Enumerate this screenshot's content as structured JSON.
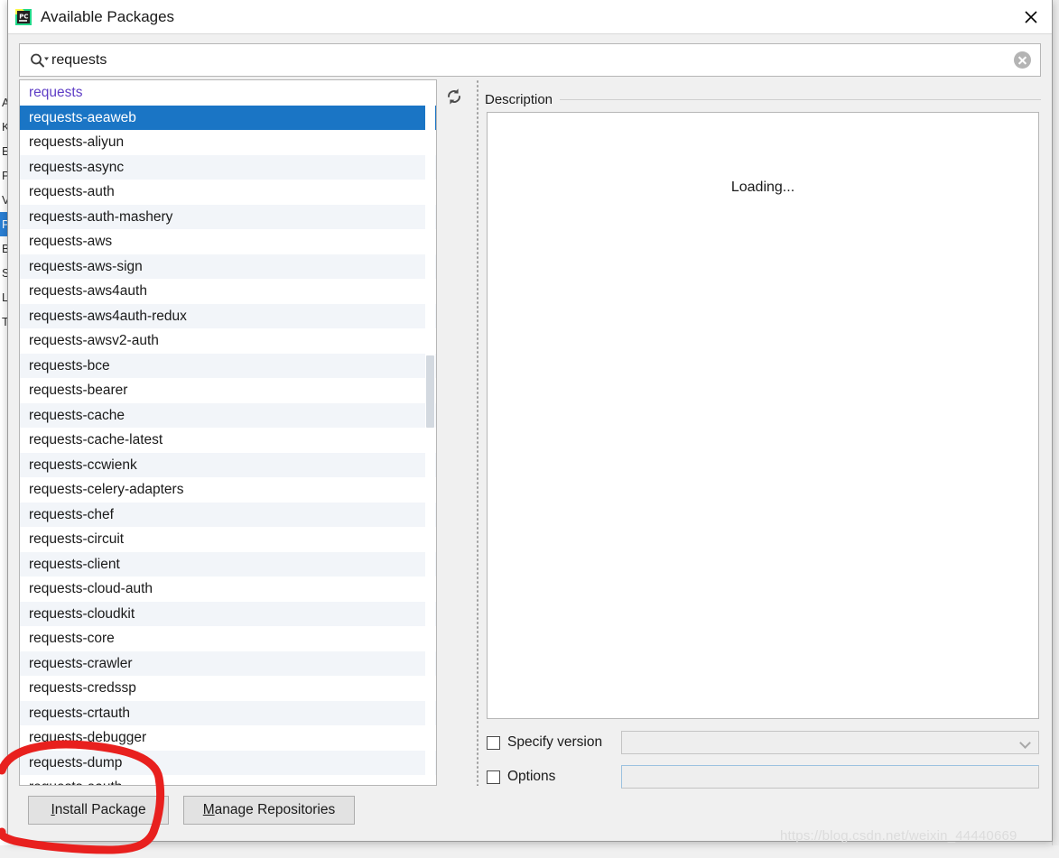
{
  "window": {
    "title": "Available Packages",
    "app_icon": "pycharm-icon",
    "close_icon": "close-icon",
    "accent_color": "#1a75c5",
    "installed_color": "#5f3ec6"
  },
  "search": {
    "value": "requests",
    "placeholder": "",
    "icon": "search-icon",
    "clear_icon": "clear-icon"
  },
  "list": {
    "refresh_icon": "refresh-icon",
    "selected_index": 1,
    "installed_index": 0,
    "items": [
      "requests",
      "requests-aeaweb",
      "requests-aliyun",
      "requests-async",
      "requests-auth",
      "requests-auth-mashery",
      "requests-aws",
      "requests-aws-sign",
      "requests-aws4auth",
      "requests-aws4auth-redux",
      "requests-awsv2-auth",
      "requests-bce",
      "requests-bearer",
      "requests-cache",
      "requests-cache-latest",
      "requests-ccwienk",
      "requests-celery-adapters",
      "requests-chef",
      "requests-circuit",
      "requests-client",
      "requests-cloud-auth",
      "requests-cloudkit",
      "requests-core",
      "requests-crawler",
      "requests-credssp",
      "requests-crtauth",
      "requests-debugger",
      "requests-dump",
      "requests-eauth"
    ]
  },
  "description": {
    "header": "Description",
    "body": "Loading..."
  },
  "options": {
    "specify_version_label": "Specify version",
    "specify_version_checked": false,
    "specify_version_value": "",
    "options_label": "Options",
    "options_checked": false,
    "options_value": "",
    "dropdown_icon": "chevron-down-icon"
  },
  "footer": {
    "install_mnemonic": "I",
    "install_rest": "nstall Package",
    "manage_mnemonic": "M",
    "manage_rest": "anage Repositories"
  },
  "annotation": {
    "shape": "red-circle-highlight",
    "color": "#e8201e"
  },
  "watermark": {
    "text": "https://blog.csdn.net/weixin_44440669"
  },
  "backdrop": {
    "tree_items": [
      "Ap",
      "Ke",
      "Ed",
      "Pl",
      "Ve",
      "Pr",
      "Bu",
      "Su",
      "La",
      "To"
    ],
    "selected_tree_index": 5
  }
}
